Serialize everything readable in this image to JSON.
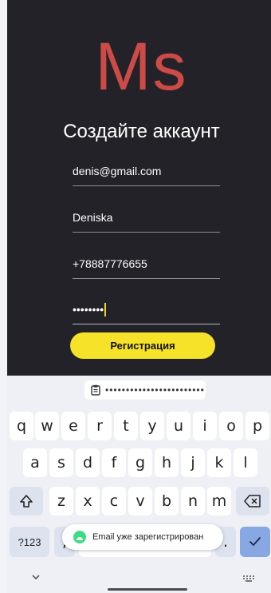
{
  "app": {
    "logo": "Ms",
    "title": "Создайте аккаунт",
    "fields": {
      "email": "denis@gmail.com",
      "username": "Deniska",
      "phone": "+78887776655",
      "password": "••••••••"
    },
    "register_button": "Регистрация"
  },
  "keyboard": {
    "clipboard_suggestion": "••••••••••••••••••••••••",
    "row1": [
      "q",
      "w",
      "e",
      "r",
      "t",
      "y",
      "u",
      "i",
      "o",
      "p"
    ],
    "row2": [
      "a",
      "s",
      "d",
      "f",
      "g",
      "h",
      "j",
      "k",
      "l"
    ],
    "row3": [
      "z",
      "x",
      "c",
      "v",
      "b",
      "n",
      "m"
    ],
    "symbols_key": "?123",
    "comma_key": ",",
    "period_key": ".",
    "icons": {
      "shift": "shift-icon",
      "backspace": "backspace-icon",
      "enter": "checkmark-icon",
      "clipboard": "clipboard-icon"
    }
  },
  "toast": {
    "message": "Email уже зарегистрирован",
    "icon": "android-icon"
  },
  "colors": {
    "background": "#232229",
    "logo": "#cd4b47",
    "button": "#f6e329",
    "caret": "#f5cf25",
    "enter_key": "#87a8e3"
  }
}
